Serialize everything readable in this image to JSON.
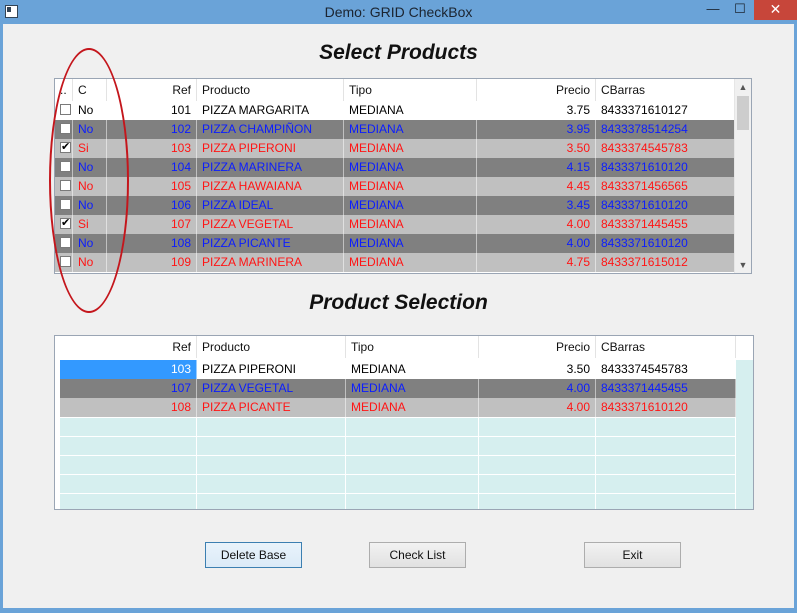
{
  "window": {
    "title": "Demo: GRID CheckBox",
    "min_symbol": "—",
    "max_symbol": "☐",
    "close_symbol": "✕"
  },
  "headings": {
    "select": "Select Products",
    "selection": "Product Selection"
  },
  "top_grid": {
    "columns": [
      "..",
      "C",
      "Ref",
      "Producto",
      "Tipo",
      "Precio",
      "CBarras"
    ],
    "rows": [
      {
        "checked": false,
        "c": "No",
        "ref": "101",
        "producto": "PIZZA MARGARITA",
        "tipo": "MEDIANA",
        "precio": "3.75",
        "cbarras": "8433371610127"
      },
      {
        "checked": false,
        "c": "No",
        "ref": "102",
        "producto": "PIZZA CHAMPIÑON",
        "tipo": "MEDIANA",
        "precio": "3.95",
        "cbarras": "8433378514254"
      },
      {
        "checked": true,
        "c": "Si",
        "ref": "103",
        "producto": "PIZZA PIPERONI",
        "tipo": "MEDIANA",
        "precio": "3.50",
        "cbarras": "8433374545783"
      },
      {
        "checked": false,
        "c": "No",
        "ref": "104",
        "producto": "PIZZA MARINERA",
        "tipo": "MEDIANA",
        "precio": "4.15",
        "cbarras": "8433371610120"
      },
      {
        "checked": false,
        "c": "No",
        "ref": "105",
        "producto": "PIZZA HAWAIANA",
        "tipo": "MEDIANA",
        "precio": "4.45",
        "cbarras": "8433371456565"
      },
      {
        "checked": false,
        "c": "No",
        "ref": "106",
        "producto": "PIZZA IDEAL",
        "tipo": "MEDIANA",
        "precio": "3.45",
        "cbarras": "8433371610120"
      },
      {
        "checked": true,
        "c": "Si",
        "ref": "107",
        "producto": "PIZZA VEGETAL",
        "tipo": "MEDIANA",
        "precio": "4.00",
        "cbarras": "8433371445455"
      },
      {
        "checked": false,
        "c": "No",
        "ref": "108",
        "producto": "PIZZA PICANTE",
        "tipo": "MEDIANA",
        "precio": "4.00",
        "cbarras": "8433371610120"
      },
      {
        "checked": false,
        "c": "No",
        "ref": "109",
        "producto": "PIZZA MARINERA",
        "tipo": "MEDIANA",
        "precio": "4.75",
        "cbarras": "8433371615012"
      }
    ]
  },
  "bottom_grid": {
    "columns": [
      "Ref",
      "Producto",
      "Tipo",
      "Precio",
      "CBarras"
    ],
    "rows": [
      {
        "ref": "103",
        "producto": "PIZZA PIPERONI",
        "tipo": "MEDIANA",
        "precio": "3.50",
        "cbarras": "8433374545783"
      },
      {
        "ref": "107",
        "producto": "PIZZA VEGETAL",
        "tipo": "MEDIANA",
        "precio": "4.00",
        "cbarras": "8433371445455"
      },
      {
        "ref": "108",
        "producto": "PIZZA PICANTE",
        "tipo": "MEDIANA",
        "precio": "4.00",
        "cbarras": "8433371610120"
      }
    ]
  },
  "buttons": {
    "delete": "Delete Base",
    "check": "Check List",
    "exit": "Exit"
  },
  "colors": {
    "titlebar": "#6aa3d8",
    "row_dark": "#808080",
    "row_light": "#c0c0c0",
    "text_blue": "#0b1dff",
    "text_red": "#ff1414",
    "selection": "#3399ff",
    "annotation": "#c4161c"
  }
}
